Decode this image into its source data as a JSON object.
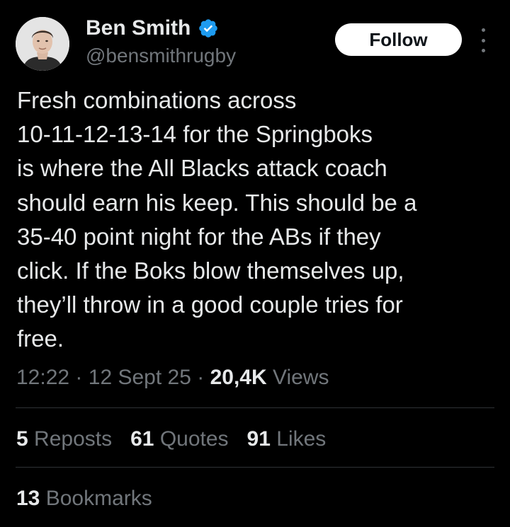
{
  "author": {
    "display_name": "Ben Smith",
    "handle": "@bensmithrugby",
    "verified_icon": "verified-badge-icon",
    "avatar_icon": "avatar-photo"
  },
  "actions": {
    "follow_label": "Follow",
    "more_icon": "more-options-icon"
  },
  "tweet": {
    "lines": [
      "Fresh combinations across",
      "10-11-12-13-14 for the Springboks",
      "is where the All Blacks attack coach",
      "should earn his keep. This should be a",
      "35-40 point night for the ABs if they",
      "click. If the Boks blow themselves up,",
      "they’ll throw in a good couple tries for",
      "free."
    ]
  },
  "meta": {
    "time": "12:22",
    "sep1": "·",
    "date": "12 Sept 25",
    "sep2": "·",
    "views_count": "20,4K",
    "views_label": "Views"
  },
  "stats": {
    "reposts_count": "5",
    "reposts_label": "Reposts",
    "quotes_count": "61",
    "quotes_label": "Quotes",
    "likes_count": "91",
    "likes_label": "Likes",
    "bookmarks_count": "13",
    "bookmarks_label": "Bookmarks"
  },
  "colors": {
    "background": "#000000",
    "primary_text": "#e7e9ea",
    "secondary_text": "#71767b",
    "verified": "#1d9bf0",
    "follow_bg": "#ffffff",
    "divider": "#2f3336"
  }
}
